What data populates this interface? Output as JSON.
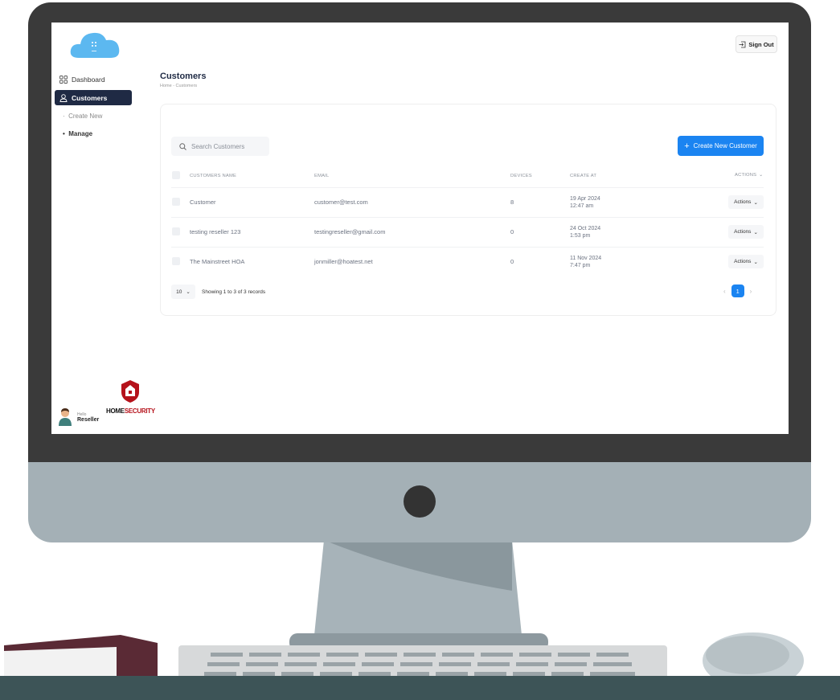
{
  "sidebar": {
    "items": [
      {
        "label": "Dashboard",
        "icon": "grid-icon"
      },
      {
        "label": "Customers",
        "icon": "user-icon"
      }
    ],
    "sub_items": [
      {
        "label": "Create New"
      },
      {
        "label": "Manage"
      }
    ],
    "user": {
      "greeting": "Hello",
      "name": "Reseller"
    },
    "brand": {
      "left": "HOME",
      "right": "SECURITY"
    }
  },
  "header": {
    "sign_out_label": "Sign Out"
  },
  "page": {
    "title": "Customers",
    "breadcrumb": "Home - Customers"
  },
  "search": {
    "placeholder": "Search Customers"
  },
  "create_button_label": "Create New Customer",
  "table": {
    "columns": [
      "CUSTOMERS NAME",
      "EMAIL",
      "DEVICES",
      "CREATE AT",
      "ACTIONS"
    ],
    "rows": [
      {
        "name": "Customer",
        "email": "customer@test.com",
        "devices": "8",
        "date": "19 Apr 2024",
        "time": "12:47 am",
        "action": "Actions"
      },
      {
        "name": "testing reseller 123",
        "email": "testingreseller@gmail.com",
        "devices": "0",
        "date": "24 Oct 2024",
        "time": "1:53 pm",
        "action": "Actions"
      },
      {
        "name": "The Mainstreet HOA",
        "email": "jonmiller@hoatest.net",
        "devices": "0",
        "date": "11 Nov 2024",
        "time": "7:47 pm",
        "action": "Actions"
      }
    ]
  },
  "pagination": {
    "page_size": "10",
    "info": "Showing 1 to 3 of 3 records",
    "current_page": "1"
  },
  "colors": {
    "accent": "#1b84f1",
    "nav_active": "#1f2a44",
    "brand_red": "#b5121b"
  }
}
